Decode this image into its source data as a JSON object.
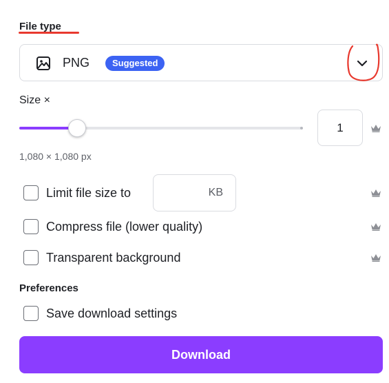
{
  "file_type": {
    "title": "File type",
    "selected_value": "PNG",
    "badge": "Suggested",
    "icon": "image-icon",
    "dropdown_icon": "chevron-down-icon"
  },
  "size": {
    "label": "Size ×",
    "value": "1",
    "slider_fraction": 0.2,
    "dimensions": "1,080 × 1,080 px",
    "premium_icon": "crown-icon"
  },
  "options": [
    {
      "label": "Limit file size to",
      "checked": false,
      "unit": "KB",
      "premium_icon": "crown-icon"
    },
    {
      "label": "Compress file (lower quality)",
      "checked": false,
      "premium_icon": "crown-icon"
    },
    {
      "label": "Transparent background",
      "checked": false,
      "premium_icon": "crown-icon"
    }
  ],
  "preferences": {
    "title": "Preferences",
    "options": [
      {
        "label": "Save download settings",
        "checked": false
      }
    ]
  },
  "download_button": {
    "label": "Download"
  },
  "colors": {
    "accent": "#8b3dff",
    "badge": "#3c63f3",
    "annotation": "#e8392e"
  }
}
